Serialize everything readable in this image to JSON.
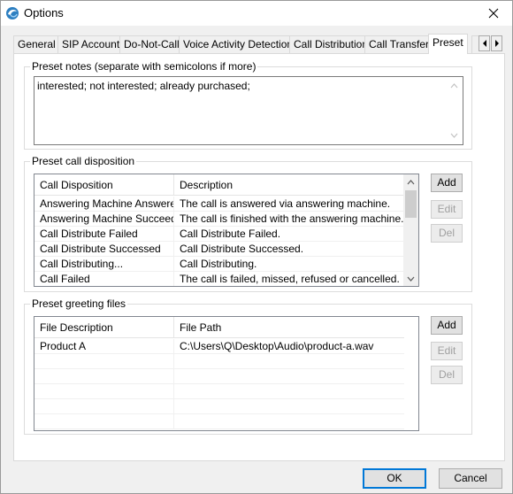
{
  "window": {
    "title": "Options"
  },
  "tabs": [
    {
      "label": "General"
    },
    {
      "label": "SIP Account"
    },
    {
      "label": "Do-Not-Call"
    },
    {
      "label": "Voice Activity Detection"
    },
    {
      "label": "Call Distribution"
    },
    {
      "label": "Call Transfer"
    },
    {
      "label": "Preset"
    }
  ],
  "active_tab": "Preset",
  "preset_notes": {
    "legend": "Preset notes (separate with semicolons if more)",
    "value": "interested; not interested; already purchased;"
  },
  "call_disposition": {
    "legend": "Preset call disposition",
    "columns": [
      "Call Disposition",
      "Description"
    ],
    "rows": [
      [
        "Answering Machine Answered",
        "The call is answered via answering machine."
      ],
      [
        "Answering Machine Succeeded",
        "The call is finished with the answering machine."
      ],
      [
        "Call Distribute Failed",
        "Call Distribute Failed."
      ],
      [
        "Call Distribute Successed",
        "Call Distribute Successed."
      ],
      [
        "Call Distributing...",
        "Call Distributing."
      ],
      [
        "Call Failed",
        "The call is failed, missed, refused or cancelled."
      ]
    ],
    "buttons": {
      "add": "Add",
      "edit": "Edit",
      "del": "Del"
    }
  },
  "greeting_files": {
    "legend": "Preset greeting files",
    "columns": [
      "File Description",
      "File Path"
    ],
    "rows": [
      [
        "Product A",
        "C:\\Users\\Q\\Desktop\\Audio\\product-a.wav"
      ]
    ],
    "buttons": {
      "add": "Add",
      "edit": "Edit",
      "del": "Del"
    }
  },
  "footer": {
    "ok": "OK",
    "cancel": "Cancel"
  },
  "icons": {
    "app": "app-icon",
    "close": "close-icon",
    "tab_scroll_left": "chevron-left-icon",
    "tab_scroll_right": "chevron-right-icon"
  },
  "colors": {
    "accent": "#0078d7",
    "app_icon_blue": "#2d7fc1"
  }
}
